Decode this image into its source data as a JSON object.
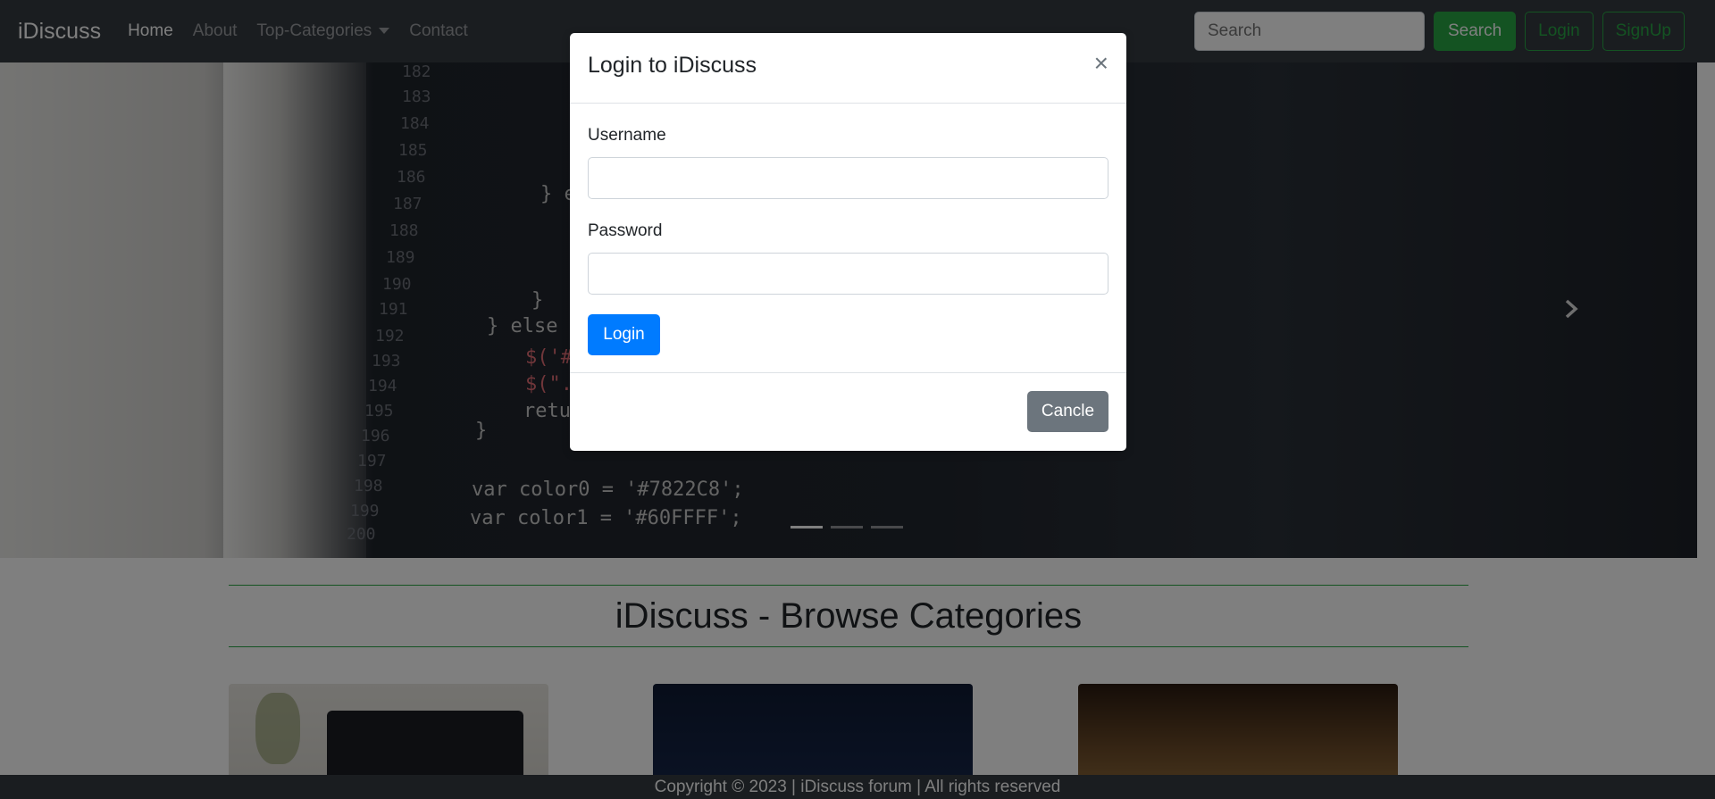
{
  "navbar": {
    "brand": "iDiscuss",
    "links": [
      "Home",
      "About",
      "Top-Categories",
      "Contact"
    ],
    "search_placeholder": "Search",
    "search_button": "Search",
    "login_button": "Login",
    "signup_button": "SignUp"
  },
  "carousel": {
    "line_numbers": [
      "182",
      "183",
      "184",
      "185",
      "186",
      "187",
      "188",
      "189",
      "190",
      "191",
      "192",
      "193",
      "194",
      "195",
      "196",
      "197",
      "198",
      "199",
      "200"
    ],
    "code_lines": [
      "} e",
      "}",
      "} else {",
      "$('#",
      "$(\".",
      "retu",
      "}",
      "var color0 = '#7822C8';",
      "var color1 = '#60FFFF';"
    ],
    "indicator_count": 3,
    "active_indicator": 1
  },
  "main": {
    "title": "iDiscuss - Browse Categories"
  },
  "footer": {
    "text": "Copyright © 2023 | iDiscuss forum | All rights reserved"
  },
  "modal": {
    "title": "Login to iDiscuss",
    "close_symbol": "×",
    "username_label": "Username",
    "password_label": "Password",
    "login_button": "Login",
    "cancel_button": "Cancle"
  },
  "colors": {
    "navbar_bg": "#343a40",
    "success": "#28a745",
    "primary": "#007bff",
    "secondary": "#6c757d"
  }
}
